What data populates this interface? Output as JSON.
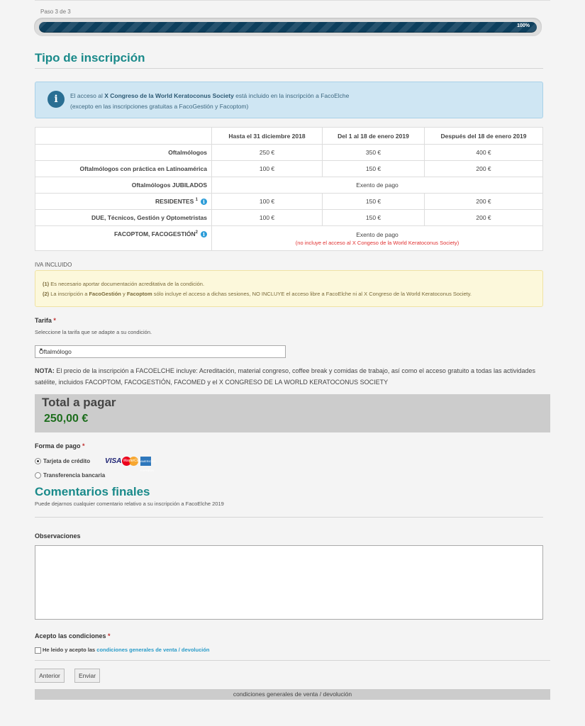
{
  "progress": {
    "step_label": "Paso 3 de 3",
    "percent": 100,
    "percent_label": "100%"
  },
  "section1": {
    "title": "Tipo de inscripción"
  },
  "info": {
    "line1_pre": "El acceso al ",
    "line1_bold": "X Congreso de la World Keratoconus Society",
    "line1_post": " está incluido en la inscripción a FacoElche",
    "line2": "(excepto en las inscripciones gratuitas a FacoGestión y Facoptom)"
  },
  "table": {
    "headers": [
      "",
      "Hasta el 31 diciembre 2018",
      "Del 1 al 18 de enero 2019",
      "Después del 18 de enero 2019"
    ],
    "rows": [
      {
        "label": "Oftalmólogos",
        "values": [
          "250 €",
          "350 €",
          "400 €"
        ]
      },
      {
        "label": "Oftalmólogos con práctica en Latinoamérica",
        "values": [
          "100 €",
          "150 €",
          "200 €"
        ]
      },
      {
        "label": "Oftalmólogos JUBILADOS",
        "exempt": "Exento de pago"
      },
      {
        "label": "RESIDENTES",
        "sup": "1",
        "values": [
          "100 €",
          "150 €",
          "200 €"
        ]
      },
      {
        "label": "DUE, Técnicos, Gestión y Optometristas",
        "values": [
          "100 €",
          "150 €",
          "200 €"
        ]
      },
      {
        "label": "FACOPTOM, FACOGESTIÓN",
        "sup": "2",
        "exempt": "Exento de pago",
        "note": "(no incluye el acceso al X Congeso de la World Keratoconus Society)"
      }
    ]
  },
  "iva": "IVA INCLUIDO",
  "notes": {
    "n1_num": "(1)",
    "n1_text": " Es necesario aportar documentación acreditativa de la condición.",
    "n2_num": "(2)",
    "n2_a": " La inscripción a ",
    "n2_b": "FacoGestión",
    "n2_c": " y ",
    "n2_d": "Facoptom",
    "n2_e": " sólo incluye el acceso a dichas sesiones, NO INCLUYE el acceso libre a FacoElche ni al X Congreso de la World Keratoconus Society."
  },
  "tarifa": {
    "label": "Tarifa",
    "required_mark": "*",
    "help": "Seleccione la tarifa que se adapte a su condición.",
    "selected": "Oftalmólogo"
  },
  "nota": {
    "bold": "NOTA:",
    "text": " El precio de la inscripción a FACOELCHE incluye: Acreditación, material congreso, coffee break y comidas de trabajo, así como el acceso gratuito a todas las actividades satélite, incluidos FACOPTOM, FACOGESTIÓN, FACOMED y el X CONGRESO DE LA WORLD KERATOCONUS SOCIETY"
  },
  "total": {
    "title": "Total a pagar",
    "amount": "250,00 €"
  },
  "payment": {
    "label": "Forma de pago",
    "required_mark": "*",
    "options": [
      "Tarjeta de crédito",
      "Transferencia bancaria"
    ],
    "selected_index": 0,
    "cards": {
      "visa": "VISA",
      "mastercard": "MasterCard",
      "amex": "AMERICAN EXPRESS"
    }
  },
  "section2": {
    "title": "Comentarios finales",
    "help": "Puede dejarnos cualquier comentario relativo a su inscripción a FacoElche 2019"
  },
  "observaciones": {
    "label": "Observaciones",
    "value": ""
  },
  "conditions": {
    "label": "Acepto las condiciones",
    "required_mark": "*",
    "check_text": "He leido y acepto las ",
    "link_text": "condiciones generales de venta / devolución"
  },
  "buttons": {
    "prev": "Anterior",
    "submit": "Enviar"
  },
  "footer": {
    "link": "condiciones generales de venta / devolución"
  },
  "colors": {
    "heading": "#1a8a8a",
    "total_amount": "#1d6e1d",
    "progress": "#0d3f5d",
    "red_note": "#e03030",
    "link": "#2a9cc9"
  }
}
